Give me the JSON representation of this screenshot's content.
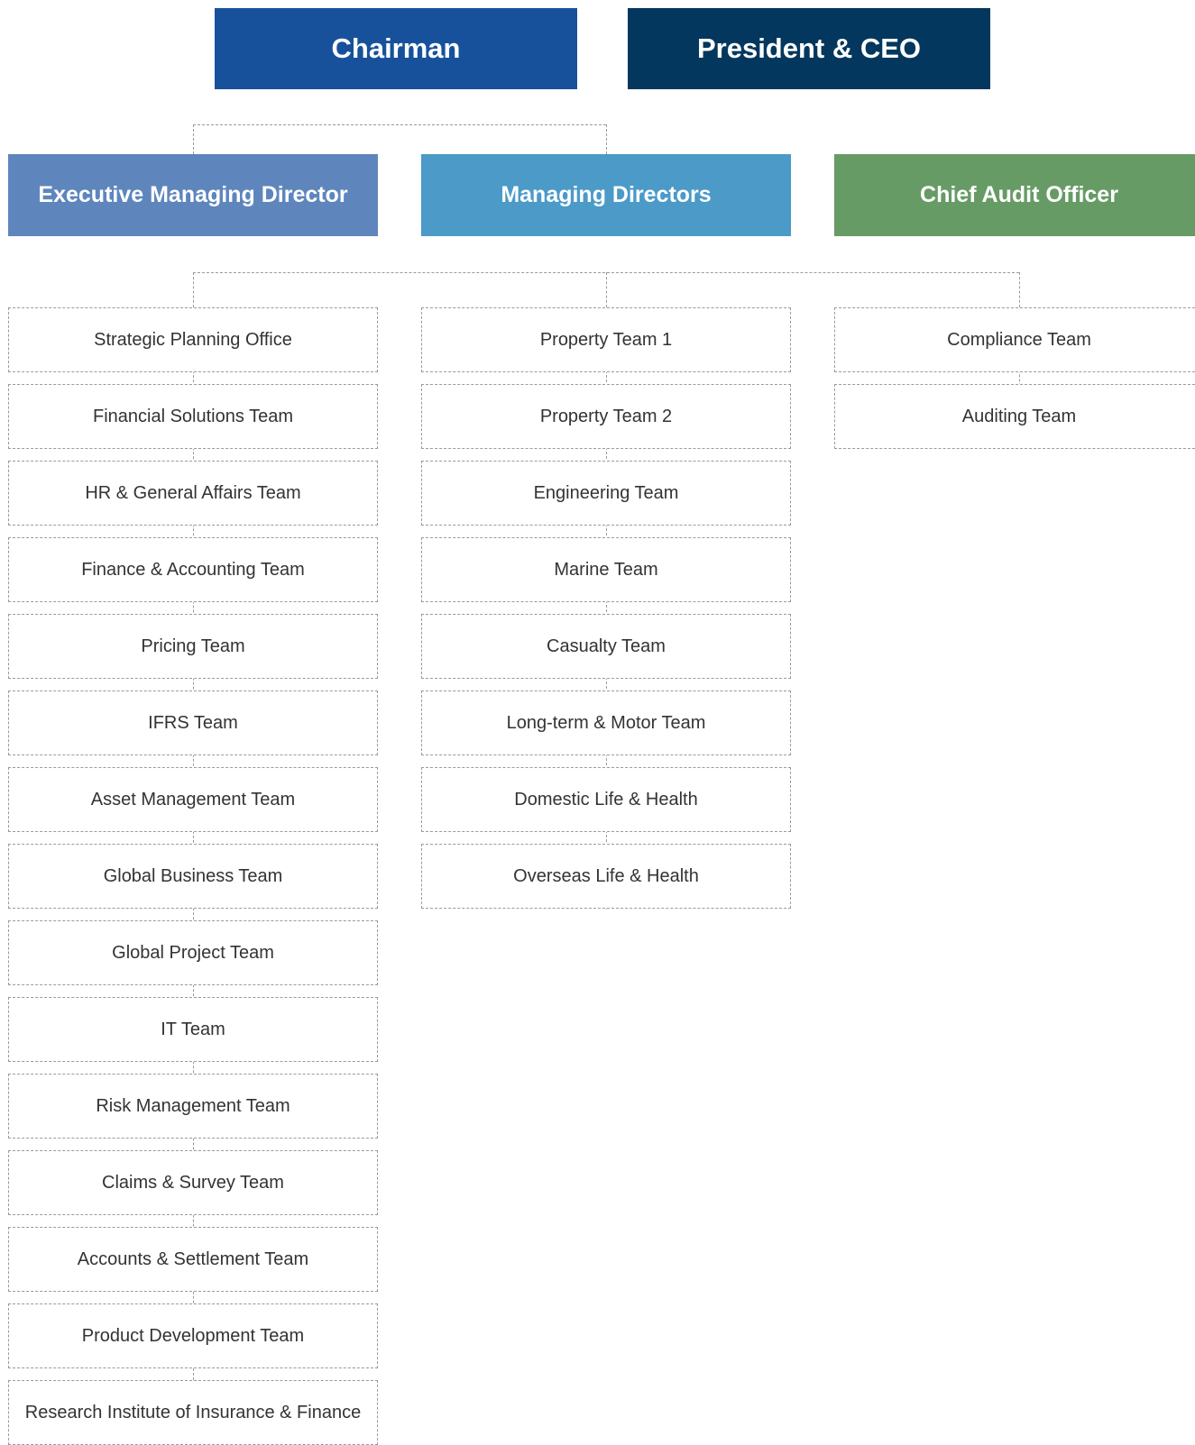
{
  "top": {
    "chairman": "Chairman",
    "president": "President & CEO"
  },
  "heads": {
    "emd": "Executive Managing Director",
    "md": "Managing Directors",
    "cao": "Chief Audit Officer"
  },
  "columns": {
    "emd": [
      "Strategic Planning Office",
      "Financial Solutions Team",
      "HR & General Affairs Team",
      "Finance & Accounting Team",
      "Pricing Team",
      "IFRS Team",
      "Asset Management Team",
      "Global Business Team",
      "Global Project Team",
      "IT Team",
      "Risk Management Team",
      "Claims & Survey Team",
      "Accounts & Settlement Team",
      "Product Development Team",
      "Research Institute of Insurance & Finance"
    ],
    "md": [
      "Property Team 1",
      "Property Team 2",
      "Engineering Team",
      "Marine Team",
      "Casualty Team",
      "Long-term & Motor Team",
      "Domestic Life & Health",
      "Overseas Life & Health"
    ],
    "cao": [
      "Compliance Team",
      "Auditing Team"
    ]
  },
  "colors": {
    "chairman": "#17519b",
    "president": "#04375e",
    "emd": "#5e86bd",
    "md": "#4b9ac8",
    "cao": "#679b65",
    "border": "#9a9a9a",
    "team_text": "#333333"
  }
}
